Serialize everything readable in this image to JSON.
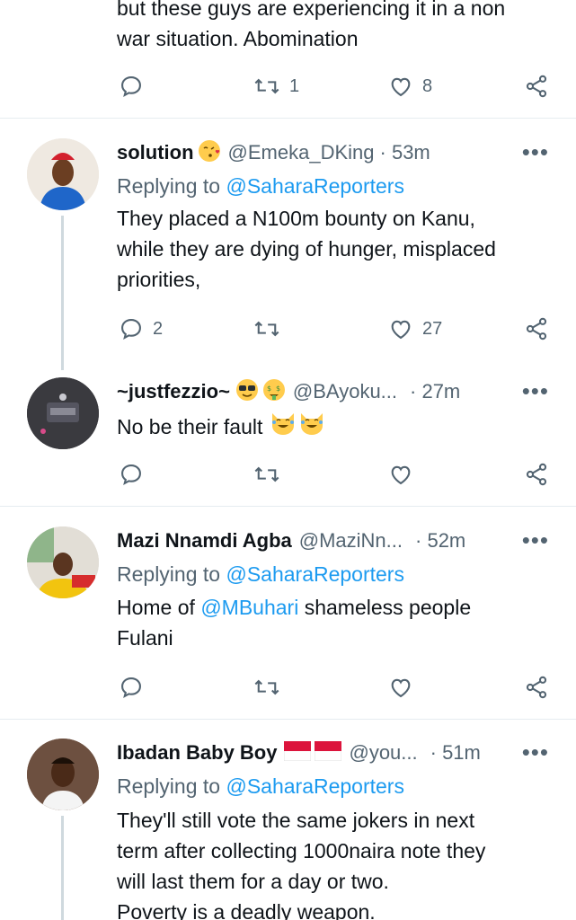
{
  "tweet0": {
    "lines": [
      "but these guys are experiencing it in a non",
      "war situation. Abomination"
    ],
    "retweets": "1",
    "likes": "8"
  },
  "reply1": {
    "name": "solution",
    "handle": "@Emeka_DKing",
    "time": "· 53m",
    "replying_prefix": "Replying to",
    "replying_to": "@SaharaReporters",
    "lines": [
      "They placed a N100m bounty on Kanu,",
      "while they are dying of hunger, misplaced",
      "priorities,"
    ],
    "replies": "2",
    "likes": "27"
  },
  "reply2": {
    "name": "~justfezzio~",
    "handle": "@BAyoku...",
    "time": "· 27m",
    "text": "No be their fault"
  },
  "reply3": {
    "name": "Mazi Nnamdi Agba",
    "handle": "@MaziNn...",
    "time": "· 52m",
    "replying_prefix": "Replying to",
    "replying_to": "@SaharaReporters",
    "mention": "@MBuhari",
    "line1_prefix": "Home of",
    "line1_suffix": "shameless people",
    "line2": "Fulani"
  },
  "reply4": {
    "name": "Ibadan Baby Boy",
    "handle": "@you...",
    "time": "· 51m",
    "replying_prefix": "Replying to",
    "replying_to": "@SaharaReporters",
    "lines": [
      "They'll still vote the same jokers in next",
      "term after collecting 1000naira note they",
      "will last them for a day or two.",
      "Poverty is a deadly weapon."
    ]
  },
  "more_label": "•••",
  "colors": {
    "link": "#1d9bf0",
    "muted": "#536471",
    "text": "#0f1419",
    "divider": "#e6ecf0"
  },
  "icons": [
    "reply-icon",
    "retweet-icon",
    "like-icon",
    "share-icon",
    "more-icon"
  ]
}
